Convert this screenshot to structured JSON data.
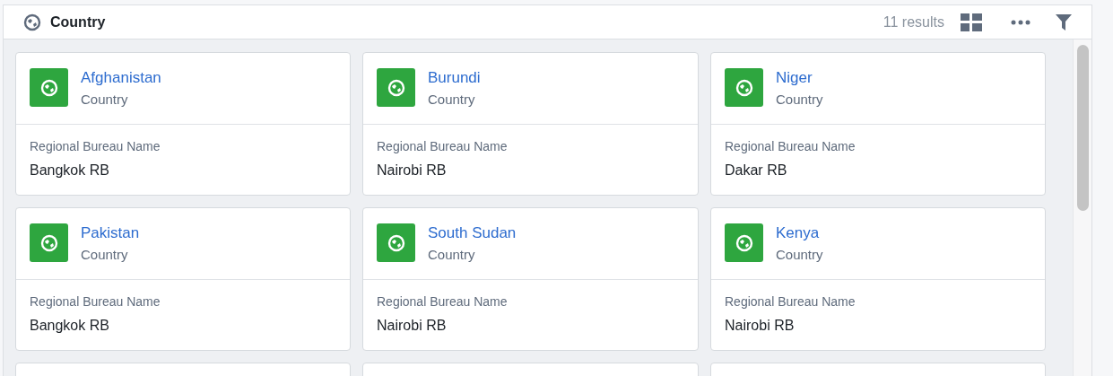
{
  "header": {
    "title": "Country",
    "result_count": "11 results"
  },
  "cards": [
    {
      "kind": "country",
      "title": "Afghanistan",
      "subtitle": "Country",
      "field_label": "Regional Bureau Name",
      "field_value": "Bangkok RB"
    },
    {
      "kind": "country",
      "title": "Burundi",
      "subtitle": "Country",
      "field_label": "Regional Bureau Name",
      "field_value": "Nairobi RB"
    },
    {
      "kind": "country",
      "title": "Niger",
      "subtitle": "Country",
      "field_label": "Regional Bureau Name",
      "field_value": "Dakar RB"
    },
    {
      "kind": "country",
      "title": "Pakistan",
      "subtitle": "Country",
      "field_label": "Regional Bureau Name",
      "field_value": "Bangkok RB"
    },
    {
      "kind": "country",
      "title": "South Sudan",
      "subtitle": "Country",
      "field_label": "Regional Bureau Name",
      "field_value": "Nairobi RB"
    },
    {
      "kind": "country",
      "title": "Kenya",
      "subtitle": "Country",
      "field_label": "Regional Bureau Name",
      "field_value": "Nairobi RB"
    },
    {
      "kind": "cut_off"
    },
    {
      "kind": "cut_off"
    },
    {
      "kind": "cut_off"
    }
  ]
}
